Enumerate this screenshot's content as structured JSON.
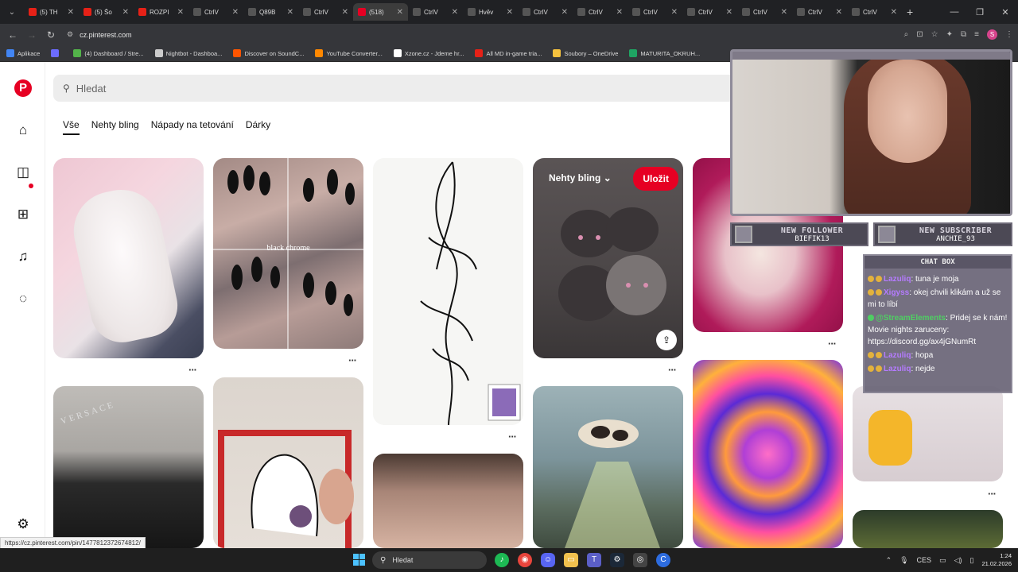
{
  "browser": {
    "tabs": [
      {
        "label": "(5) TH",
        "color": "#e62117"
      },
      {
        "label": "(5) Šo",
        "color": "#e62117"
      },
      {
        "label": "ROZPI",
        "color": "#e62117"
      },
      {
        "label": "CtrlV",
        "color": "#555555"
      },
      {
        "label": "Q89B",
        "color": "#555555"
      },
      {
        "label": "CtrlV",
        "color": "#555555"
      },
      {
        "label": "(518)",
        "color": "#e60023"
      },
      {
        "label": "CtrlV",
        "color": "#555555"
      },
      {
        "label": "Hvěv",
        "color": "#555555"
      },
      {
        "label": "CtrlV",
        "color": "#555555"
      },
      {
        "label": "CtrlV",
        "color": "#555555"
      },
      {
        "label": "CtrlV",
        "color": "#555555"
      },
      {
        "label": "CtrlV",
        "color": "#555555"
      },
      {
        "label": "CtrlV",
        "color": "#555555"
      },
      {
        "label": "CtrlV",
        "color": "#555555"
      },
      {
        "label": "CtrlV",
        "color": "#555555"
      }
    ],
    "url": "cz.pinterest.com",
    "bookmarks": [
      {
        "label": "Aplikace",
        "color": "#4285f4"
      },
      {
        "label": "",
        "color": "#6c6cff"
      },
      {
        "label": "(4) Dashboard / Stre...",
        "color": "#53b44a"
      },
      {
        "label": "Nightbot - Dashboa...",
        "color": "#cccccc"
      },
      {
        "label": "Discover on SoundC...",
        "color": "#ff5500"
      },
      {
        "label": "YouTube Converter...",
        "color": "#ff8800"
      },
      {
        "label": "Xzone.cz - Jdeme hr...",
        "color": "#ffffff"
      },
      {
        "label": "All MD in-game tria...",
        "color": "#e62117"
      },
      {
        "label": "Soubory – OneDrive",
        "color": "#f6c23e"
      },
      {
        "label": "MATURITA_OKRUH...",
        "color": "#1fa463"
      }
    ]
  },
  "pinterest": {
    "search_placeholder": "Hledat",
    "chips": [
      "Vše",
      "Nehty bling",
      "Nápady na tetování",
      "Dárky"
    ],
    "hover_pin": {
      "board": "Nehty bling",
      "save": "Uložit"
    },
    "nails_caption": "black chrome",
    "boots_brand": "VERSACE"
  },
  "stream": {
    "follower": {
      "title": "NEW FOLLOWER",
      "name": "BIEFIK13"
    },
    "subscriber": {
      "title": "NEW SUBSCRIBER",
      "name": "ANCHIE_93"
    },
    "chat_title": "CHAT BOX",
    "messages": [
      {
        "user": "Lazuliq",
        "text": ": tuna je moja"
      },
      {
        "user": "Xigyss",
        "text": ": okej chvili klikám a už se mi to líbí"
      },
      {
        "user": "@StreamElements",
        "text": ": Pridej se k nám! Movie nights zaruceny: https://discord.gg/ax4jGNumRt"
      },
      {
        "user": "Lazuliq",
        "text": ": hopa"
      },
      {
        "user": "Lazuliq",
        "text": ": nejde"
      }
    ]
  },
  "status_url": "https://cz.pinterest.com/pin/1477812372674812/",
  "taskbar": {
    "search_placeholder": "Hledat",
    "lang": "CES",
    "time": "1:24",
    "date": "21.02.2026"
  }
}
